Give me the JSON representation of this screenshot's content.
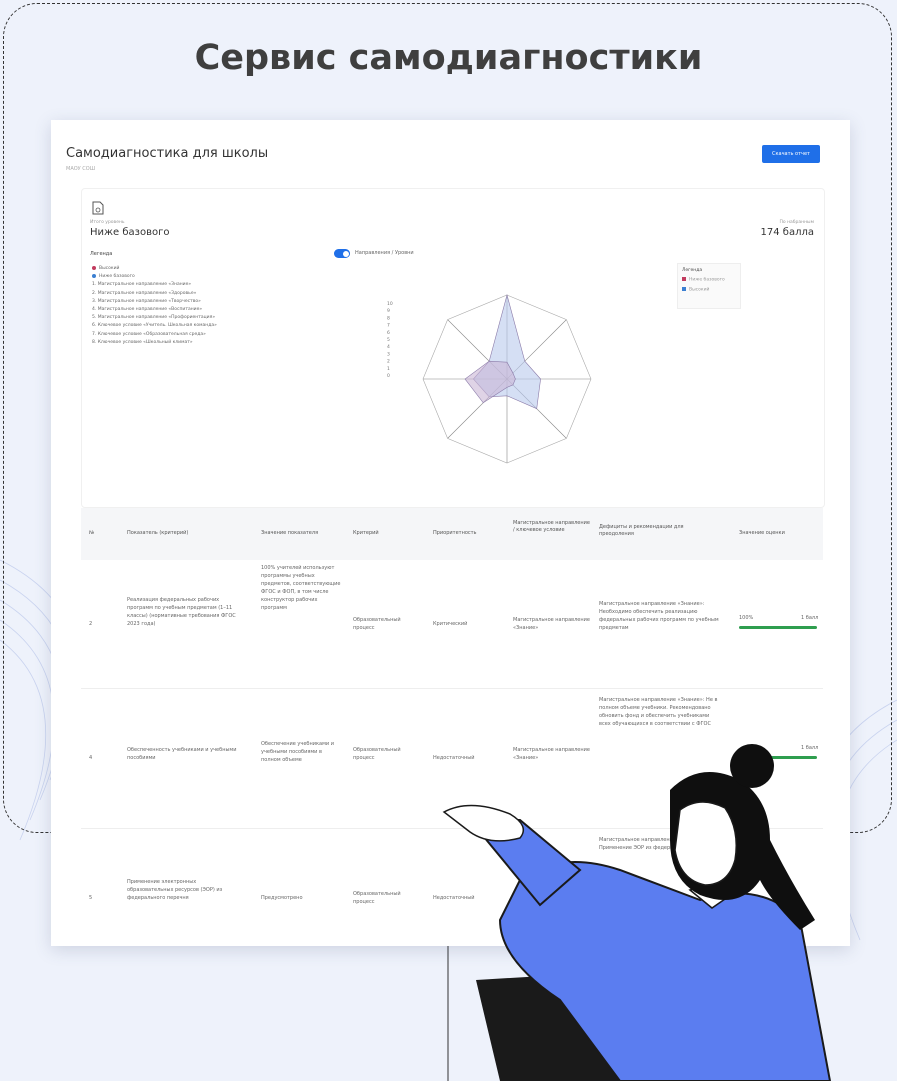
{
  "slide": {
    "title": "Сервис самодиагностики"
  },
  "app": {
    "title": "Самодиагностика для школы",
    "subtitle": "МАОУ СОШ",
    "report_button": "Скачать отчет"
  },
  "summary": {
    "level_label": "Итого уровень",
    "level": "Ниже базового",
    "score_label": "По набранным",
    "score": "174 балла"
  },
  "legend": {
    "title": "Легенда",
    "levels": [
      {
        "label": "Высокий",
        "color": "#c23b5e"
      },
      {
        "label": "Ниже базового",
        "color": "#3b7fd1"
      }
    ],
    "items": [
      "1. Магистральное направление «Знание»",
      "2. Магистральное направление «Здоровье»",
      "3. Магистральное направление «Творчество»",
      "4. Магистральное направление «Воспитание»",
      "5. Магистральное направление «Профориентация»",
      "6. Ключевое условие «Учитель. Школьная команда»",
      "7. Ключевое условие «Образовательная среда»",
      "8. Ключевое условие «Школьный климат»"
    ]
  },
  "chart_controls": {
    "toggle_label": "Направления / Уровни",
    "legend_title": "Легенда",
    "legend_items": [
      "Ниже базового",
      "Высокий"
    ]
  },
  "chart_data": {
    "type": "radar",
    "axis_ticks": [
      "10",
      "9",
      "8",
      "7",
      "6",
      "5",
      "4",
      "3",
      "2",
      "1",
      "0"
    ],
    "series": [
      {
        "name": "Высокий",
        "color": "#b9c9ec",
        "values": [
          10,
          3,
          4,
          5,
          2,
          3,
          4,
          3
        ]
      },
      {
        "name": "Ниже базового",
        "color": "#c9b6d6",
        "values": [
          2,
          1,
          1,
          1,
          1,
          4,
          5,
          3
        ]
      }
    ]
  },
  "table": {
    "headers": [
      "№",
      "Показатель (критерий)",
      "Значение показателя",
      "Критерий",
      "Приоритетность",
      "Магистральное направление / ключевое условие",
      "Дефициты и рекомендации для преодоления",
      "Значение оценки"
    ],
    "rows": [
      {
        "num": "2",
        "indicator": "Реализация федеральных рабочих программ по учебным предметам (1–11 классы) (нормативные требования ФГОС 2023 года)",
        "value": "100% учителей используют программы учебных предметов, соответствующие ФГОС и ФОП, в том числе конструктор рабочих программ",
        "criterion": "Образовательный процесс",
        "priority": "Критический",
        "direction": "Магистральное направление «Знание»",
        "deficit": "Магистральное направление «Знание»: Необходимо обеспечить реализацию федеральных рабочих программ по учебным предметам",
        "score_label": "100%",
        "score_max": "1 балл",
        "progress": 1.0
      },
      {
        "num": "4",
        "indicator": "Обеспеченность учебниками и учебными пособиями",
        "value": "Обеспечение учебниками и учебными пособиями в полном объеме",
        "criterion": "Образовательный процесс",
        "priority": "Недостаточный",
        "direction": "Магистральное направление «Знание»",
        "deficit": "Магистральное направление «Знание»: Не в полном объеме учебники. Рекомендовано обновить фонд и обеспечить учебниками всех обучающихся в соответствии с ФГОС",
        "score_label": "",
        "score_max": "1 балл",
        "progress": 1.0
      },
      {
        "num": "5",
        "indicator": "Применение электронных образовательных ресурсов (ЭОР) из федерального перечня",
        "value": "Предусмотрено",
        "criterion": "Образовательный процесс",
        "priority": "Недостаточный",
        "direction": "",
        "deficit": "Магистральное направление «Знание»: Применение ЭОР из федерального перечня",
        "score_label": "",
        "score_max": "",
        "progress": 0.0
      }
    ]
  }
}
